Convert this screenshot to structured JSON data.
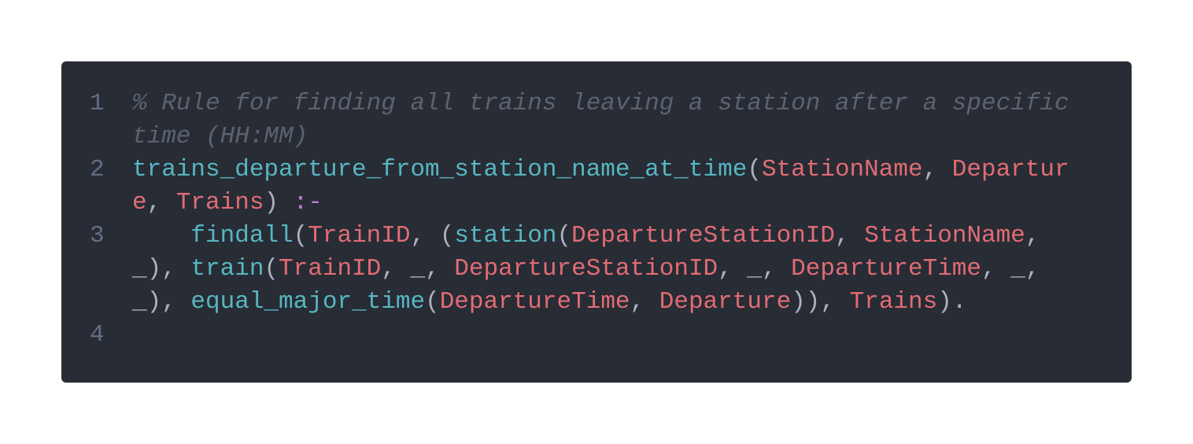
{
  "editor": {
    "lines": [
      {
        "number": "1",
        "tokens": [
          {
            "type": "comment",
            "text": "% Rule for finding all trains leaving a station after a specific time (HH:MM)"
          }
        ]
      },
      {
        "number": "2",
        "tokens": [
          {
            "type": "func",
            "text": "trains_departure_from_station_name_at_time"
          },
          {
            "type": "punct",
            "text": "("
          },
          {
            "type": "var",
            "text": "StationName"
          },
          {
            "type": "punct",
            "text": ", "
          },
          {
            "type": "var",
            "text": "Departure"
          },
          {
            "type": "punct",
            "text": ", "
          },
          {
            "type": "var",
            "text": "Trains"
          },
          {
            "type": "punct",
            "text": ") "
          },
          {
            "type": "op",
            "text": ":-"
          }
        ]
      },
      {
        "number": "3",
        "tokens": [
          {
            "type": "punct",
            "text": "    "
          },
          {
            "type": "func",
            "text": "findall"
          },
          {
            "type": "punct",
            "text": "("
          },
          {
            "type": "var",
            "text": "TrainID"
          },
          {
            "type": "punct",
            "text": ", ("
          },
          {
            "type": "func",
            "text": "station"
          },
          {
            "type": "punct",
            "text": "("
          },
          {
            "type": "var",
            "text": "DepartureStationID"
          },
          {
            "type": "punct",
            "text": ", "
          },
          {
            "type": "var",
            "text": "StationName"
          },
          {
            "type": "punct",
            "text": ", _), "
          },
          {
            "type": "func",
            "text": "train"
          },
          {
            "type": "punct",
            "text": "("
          },
          {
            "type": "var",
            "text": "TrainID"
          },
          {
            "type": "punct",
            "text": ", _, "
          },
          {
            "type": "var",
            "text": "DepartureStationID"
          },
          {
            "type": "punct",
            "text": ", _, "
          },
          {
            "type": "var",
            "text": "DepartureTime"
          },
          {
            "type": "punct",
            "text": ", _, _), "
          },
          {
            "type": "func",
            "text": "equal_major_time"
          },
          {
            "type": "punct",
            "text": "("
          },
          {
            "type": "var",
            "text": "DepartureTime"
          },
          {
            "type": "punct",
            "text": ", "
          },
          {
            "type": "var",
            "text": "Departure"
          },
          {
            "type": "punct",
            "text": ")), "
          },
          {
            "type": "var",
            "text": "Trains"
          },
          {
            "type": "punct",
            "text": ")."
          }
        ]
      },
      {
        "number": "4",
        "tokens": []
      }
    ],
    "colors": {
      "background": "#282c34",
      "comment": "#5c6370",
      "function": "#56b6c2",
      "variable": "#e06c75",
      "operator": "#c678dd",
      "punctuation": "#abb2bf",
      "line_number": "#636d83"
    }
  }
}
